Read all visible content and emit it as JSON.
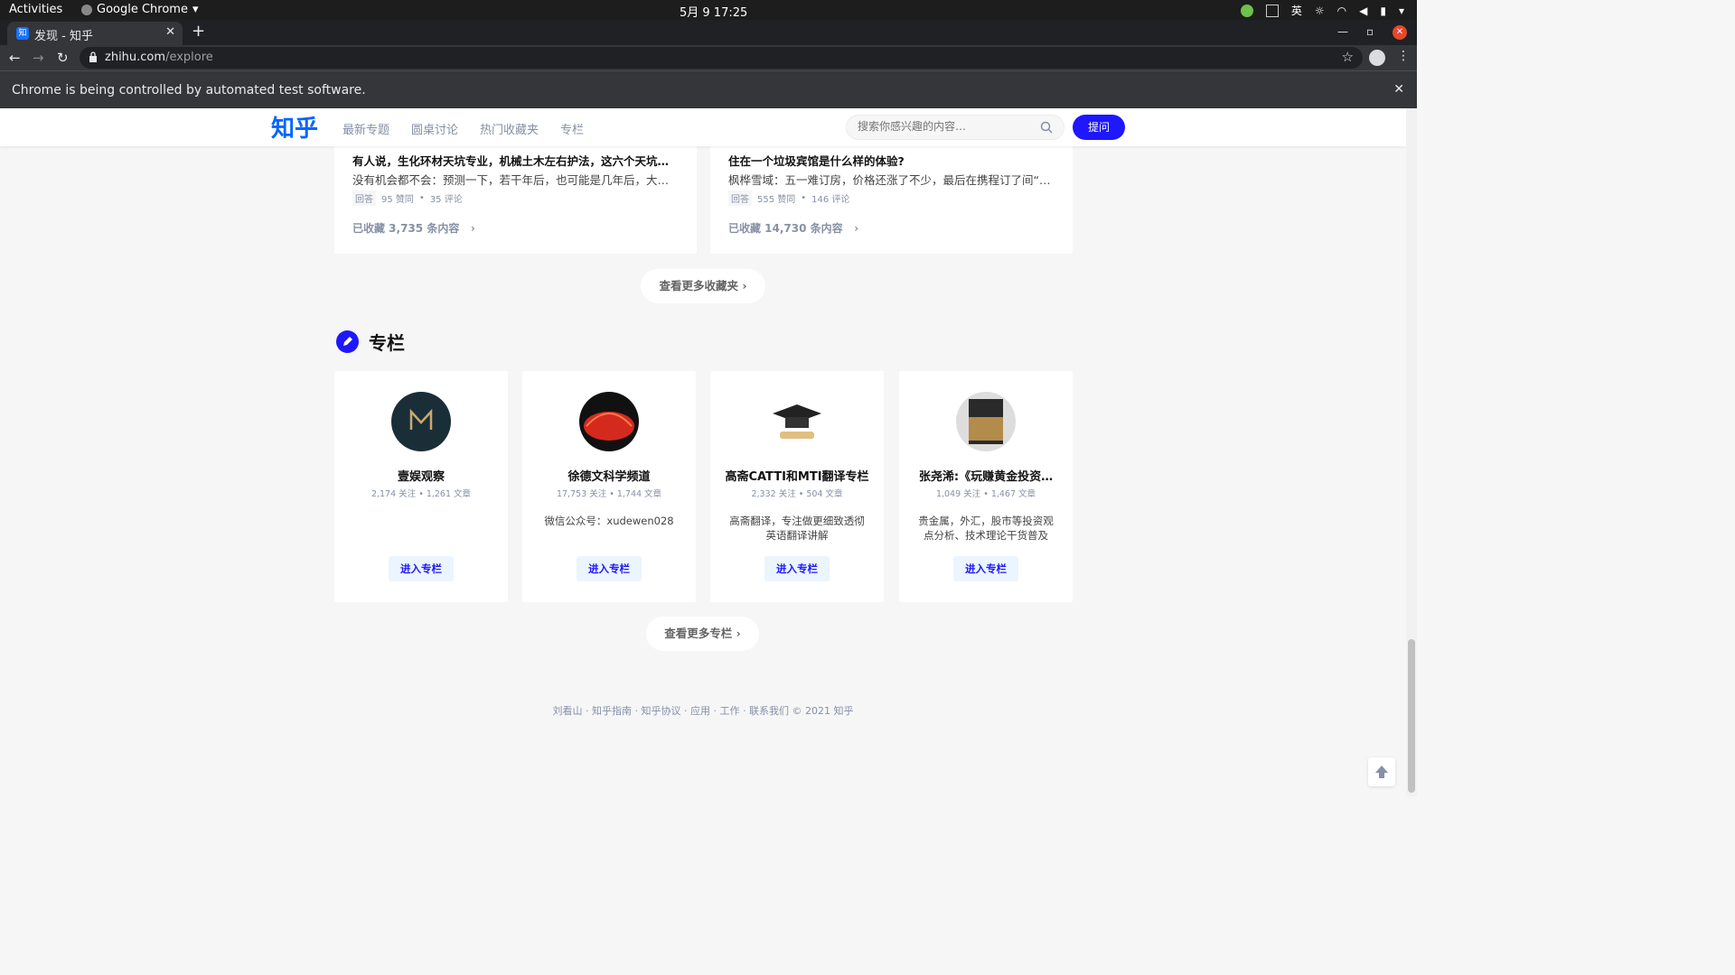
{
  "os": {
    "activities": "Activities",
    "app_name": "Google Chrome",
    "clock": "5月 9  17:25",
    "ime": "英"
  },
  "browser": {
    "tab_title": "发现 - 知乎",
    "favicon_text": "知",
    "url_host": "zhihu.com",
    "url_path": "/explore",
    "infobar": "Chrome is being controlled by automated test software."
  },
  "header": {
    "logo": "知乎",
    "nav": [
      "最新专题",
      "圆桌讨论",
      "热门收藏夹",
      "专栏"
    ],
    "search_placeholder": "搜索你感兴趣的内容…",
    "ask_button": "提问"
  },
  "collections": [
    {
      "question": "有人说，生化环材天坑专业，机械土木左右护法，这六个天坑，…",
      "answer": "没有机会都不会：预测一下，若干年后，也可能是几年后，大部…",
      "tag": "回答",
      "votes": "95 赞同",
      "comments": "35 评论",
      "count": "已收藏 3,735 条内容"
    },
    {
      "question": "住在一个垃圾宾馆是什么样的体验?",
      "answer": "枫桦雪域：五一难订房，价格还涨了不少，最后在携程订了间“…",
      "tag": "回答",
      "votes": "555 赞同",
      "comments": "146 评论",
      "count": "已收藏 14,730 条内容"
    }
  ],
  "more_collections": "查看更多收藏夹",
  "columns_title": "专栏",
  "columns": [
    {
      "name": "壹娱观察",
      "stats": "2,174 关注  •  1,261 文章",
      "desc": "",
      "button": "进入专栏",
      "avatar": "logo-dark"
    },
    {
      "name": "徐德文科学频道",
      "stats": "17,753 关注  •  1,744 文章",
      "desc": "微信公众号：xudewen028",
      "button": "进入专栏",
      "avatar": "red-dome"
    },
    {
      "name": "高斋CATTI和MTI翻译专栏",
      "stats": "2,332 关注  •  504 文章",
      "desc": "高斋翻译，专注做更细致透彻英语翻译讲解",
      "button": "进入专栏",
      "avatar": "graduation-cap"
    },
    {
      "name": "张尧浠:《玩赚黄金投资…",
      "stats": "1,049 关注  •  1,467 文章",
      "desc": "贵金属，外汇，股市等投资观点分析、技术理论干货普及",
      "button": "进入专栏",
      "avatar": "book-cover"
    }
  ],
  "more_columns": "查看更多专栏",
  "footer": "刘看山  ·  知乎指南  ·  知乎协议  ·  应用  ·  工作  ·  联系我们 © 2021 知乎",
  "colors": {
    "brand": "#1e17ff",
    "logo": "#0066ff"
  }
}
